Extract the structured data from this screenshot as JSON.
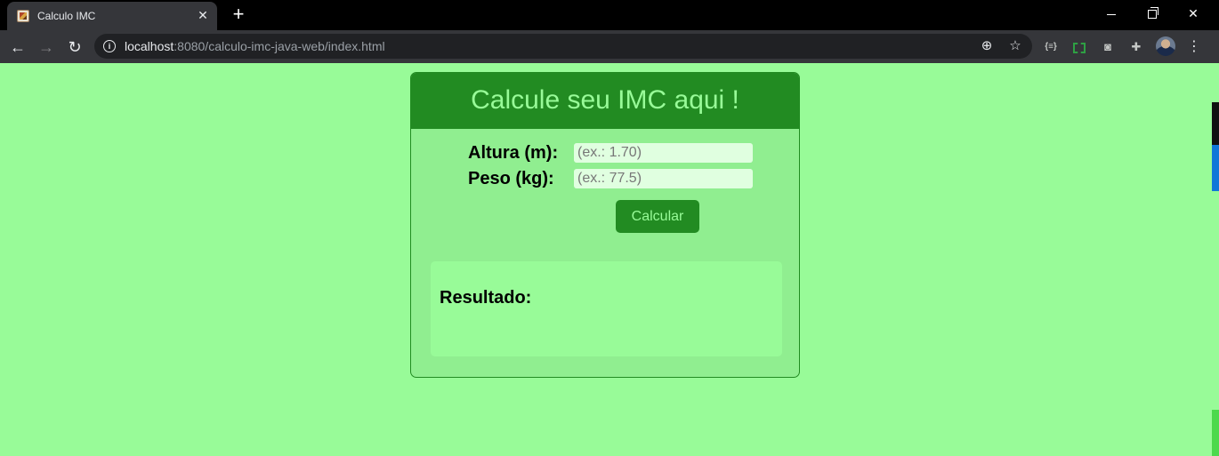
{
  "browser": {
    "tab_title": "Calculo IMC",
    "tab_close": "✕",
    "new_tab": "+",
    "url_host": "localhost",
    "url_rest": ":8080/calculo-imc-java-web/index.html",
    "ext_json_label": "{≡}",
    "icons": {
      "back": "arrow-left-icon",
      "forward": "arrow-right-icon",
      "reload": "reload-icon",
      "info": "info-icon",
      "zoom": "zoom-icon",
      "star": "star-icon",
      "camera": "camera-icon",
      "puzzle": "puzzle-icon",
      "menu": "menu-dots-icon"
    }
  },
  "page": {
    "title": "Calcule seu IMC aqui !",
    "altura_label": "Altura (m):",
    "altura_placeholder": "(ex.: 1.70)",
    "peso_label": "Peso (kg):",
    "peso_placeholder": "(ex.: 77.5)",
    "button_label": "Calcular",
    "result_label": "Resultado:"
  },
  "colors": {
    "page_background": "#98fb98",
    "card_background": "#90ee90",
    "header_background": "#228b22",
    "header_text": "#98fb98",
    "input_background": "#e0ffe0"
  }
}
